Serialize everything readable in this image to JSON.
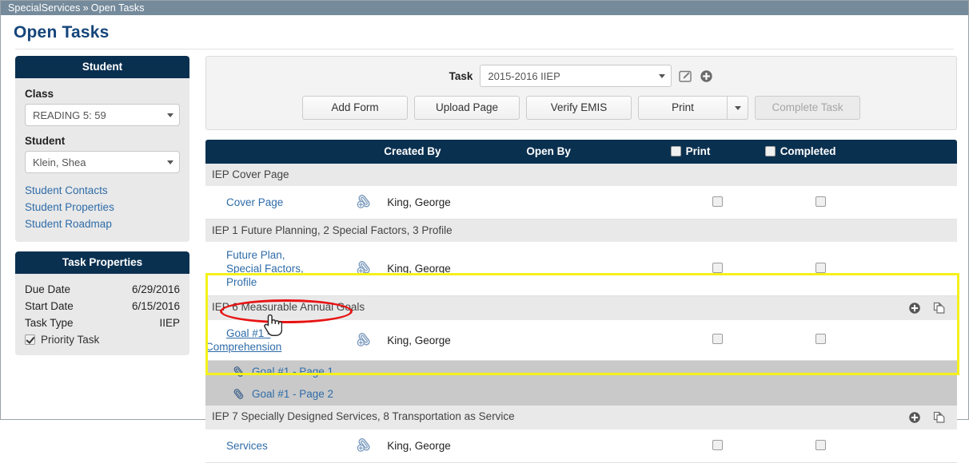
{
  "breadcrumb": {
    "root": "SpecialServices",
    "separator": "»",
    "current": "Open Tasks"
  },
  "page": {
    "title": "Open Tasks"
  },
  "sidebar": {
    "student_panel": {
      "header": "Student",
      "class_label": "Class",
      "class_value": "READING 5: 59",
      "student_label": "Student",
      "student_value": "Klein, Shea",
      "links": [
        "Student Contacts",
        "Student Properties",
        "Student Roadmap"
      ]
    },
    "task_properties_panel": {
      "header": "Task Properties",
      "rows": [
        {
          "label": "Due Date",
          "value": "6/29/2016"
        },
        {
          "label": "Start Date",
          "value": "6/15/2016"
        },
        {
          "label": "Task Type",
          "value": "IIEP"
        }
      ],
      "priority_label": "Priority Task",
      "priority_checked": true
    }
  },
  "toolbar": {
    "task_label": "Task",
    "task_value": "2015-2016 IIEP",
    "edit_icon": "edit-pencil-icon",
    "add_icon": "add-circle-icon",
    "buttons": [
      {
        "label": "Add Form",
        "disabled": false
      },
      {
        "label": "Upload Page",
        "disabled": false
      },
      {
        "label": "Verify EMIS",
        "disabled": false
      }
    ],
    "print_label": "Print",
    "complete_label": "Complete Task",
    "complete_disabled": true
  },
  "table": {
    "headers": {
      "name": "",
      "attachment": "",
      "created_by": "Created By",
      "open_by": "Open By",
      "print": "Print",
      "completed": "Completed"
    },
    "groups": [
      {
        "title": "IEP Cover Page",
        "has_group_icons": false,
        "items": [
          {
            "name": "Cover Page",
            "created_by": "King, George",
            "open_by": "",
            "print": false,
            "completed": false,
            "attachment_icon": "paperclip-add-icon",
            "highlighted": false,
            "subpages": []
          }
        ]
      },
      {
        "title": "IEP 1 Future Planning, 2 Special Factors, 3 Profile",
        "has_group_icons": false,
        "items": [
          {
            "name": "Future Plan, Special Factors, Profile",
            "created_by": "King, George",
            "open_by": "",
            "print": false,
            "completed": false,
            "attachment_icon": "paperclip-add-icon",
            "highlighted": false,
            "subpages": []
          }
        ]
      },
      {
        "title": "IEP 6 Measurable Annual Goals",
        "has_group_icons": true,
        "items": [
          {
            "name": "Goal #1 - Comprehension",
            "created_by": "King, George",
            "open_by": "",
            "print": false,
            "completed": false,
            "attachment_icon": "paperclip-add-icon",
            "highlighted": true,
            "subpages": [
              {
                "name": "Goal #1 - Page 1"
              },
              {
                "name": "Goal #1 - Page 2"
              }
            ]
          }
        ]
      },
      {
        "title": "IEP 7 Specially Designed Services, 8 Transportation as Service",
        "has_group_icons": true,
        "items": [
          {
            "name": "Services",
            "created_by": "King, George",
            "open_by": "",
            "print": false,
            "completed": false,
            "attachment_icon": "paperclip-add-icon",
            "highlighted": false,
            "subpages": []
          }
        ]
      }
    ],
    "group_icons": {
      "add": "add-circle-icon",
      "copy": "copy-pages-icon"
    }
  },
  "annotations": {
    "highlight_color": "#f5f11a",
    "oval_color": "#e81313",
    "cursor": "pointer-hand-cursor"
  },
  "colors": {
    "header_navy": "#0a3050",
    "breadcrumb_gray": "#758b9c",
    "link_blue": "#2f6ca8",
    "title_blue": "#14457a"
  }
}
